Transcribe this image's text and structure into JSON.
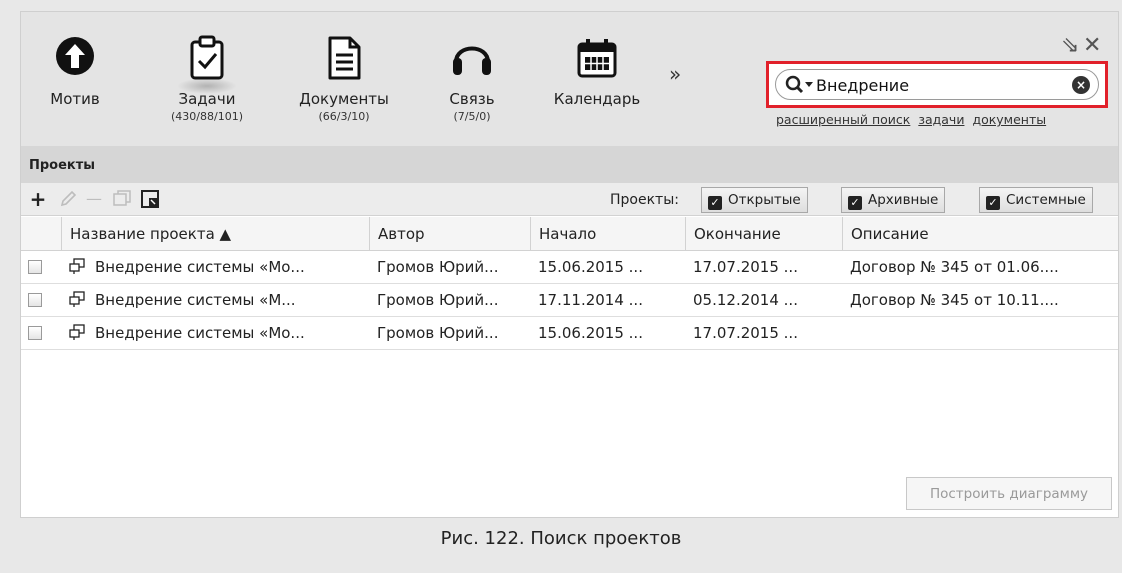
{
  "toolbar": {
    "items": [
      {
        "label": "Мотив",
        "count": "",
        "icon": "arrow-up-circle-icon"
      },
      {
        "label": "Задачи",
        "count": "(430/88/101)",
        "icon": "clipboard-check-icon"
      },
      {
        "label": "Документы",
        "count": "(66/3/10)",
        "icon": "document-icon"
      },
      {
        "label": "Связь",
        "count": "(7/5/0)",
        "icon": "headset-icon"
      },
      {
        "label": "Календарь",
        "count": "",
        "icon": "calendar-icon"
      }
    ],
    "more": "»",
    "restore_icon": "⇘",
    "close_icon": "✕"
  },
  "search": {
    "value": "Внедрение",
    "placeholder": "",
    "links": [
      "расширенный поиск",
      "задачи",
      "документы"
    ]
  },
  "section": {
    "title": "Проекты"
  },
  "actions": {
    "add": "+",
    "remove": "—",
    "filter_label": "Проекты:",
    "filters": [
      {
        "label": "Открытые",
        "checked": true
      },
      {
        "label": "Архивные",
        "checked": true
      },
      {
        "label": "Системные",
        "checked": true
      }
    ]
  },
  "table": {
    "columns": [
      "Название проекта ▲",
      "Автор",
      "Начало",
      "Окончание",
      "Описание"
    ],
    "rows": [
      {
        "name": "Внедрение системы «Мо...",
        "author": "Громов Юрий...",
        "start": "15.06.2015 ...",
        "end": "17.07.2015 ...",
        "desc": "Договор № 345 от 01.06...."
      },
      {
        "name": "Внедрение системы «М...",
        "author": "Громов Юрий...",
        "start": "17.11.2014 ...",
        "end": "05.12.2014 ...",
        "desc": "Договор № 345 от 10.11...."
      },
      {
        "name": "Внедрение системы «Мо...",
        "author": "Громов Юрий...",
        "start": "15.06.2015 ...",
        "end": "17.07.2015 ...",
        "desc": ""
      }
    ]
  },
  "chart_button": "Построить диаграмму",
  "caption": "Рис. 122. Поиск проектов",
  "colors": {
    "search_highlight": "#e1202a"
  }
}
